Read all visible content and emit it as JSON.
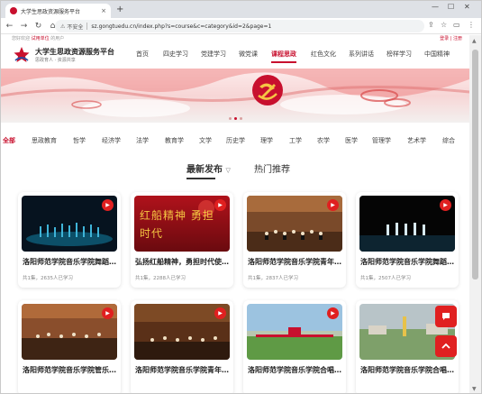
{
  "browser": {
    "tab_title": "大学生思政资源服务平台",
    "tab_close": "×",
    "new_tab": "+",
    "security_label": "不安全",
    "url": "sz.gongtuedu.cn/index.php?s=course&c=category&id=2&page=1"
  },
  "topline": {
    "prefix": "您好欢迎",
    "link": "试用单位",
    "suffix": "的用户",
    "right": "登录 | 注册"
  },
  "site": {
    "title": "大学生思政资源服务平台",
    "subtitle": "思政育人 · 资源共享"
  },
  "main_nav": [
    "首页",
    "四史学习",
    "党建学习",
    "微党课",
    "课程思政",
    "红色文化",
    "系列讲话",
    "榜样学习",
    "中国精神"
  ],
  "main_nav_active": "课程思政",
  "categories": [
    "全部",
    "思政教育",
    "哲学",
    "经济学",
    "法学",
    "教育学",
    "文学",
    "历史学",
    "理学",
    "工学",
    "农学",
    "医学",
    "管理学",
    "艺术学",
    "综合"
  ],
  "sort_tabs": {
    "latest": "最新发布",
    "latest_arrow": "▽",
    "hot": "热门推荐"
  },
  "cards": [
    {
      "title": "洛阳师范学院音乐学院舞蹈...",
      "meta": "共1集，2635人已学习"
    },
    {
      "title": "弘扬红船精神，勇担时代使...",
      "meta": "共1集，2288人已学习",
      "art_text": "红船精神  勇担时代"
    },
    {
      "title": "洛阳师范学院音乐学院青年...",
      "meta": "共1集，2837人已学习"
    },
    {
      "title": "洛阳师范学院音乐学院舞蹈...",
      "meta": "共1集，2507人已学习"
    },
    {
      "title": "洛阳师范学院音乐学院管乐...",
      "meta": ""
    },
    {
      "title": "洛阳师范学院音乐学院青年...",
      "meta": ""
    },
    {
      "title": "洛阳师范学院音乐学院合唱...",
      "meta": ""
    },
    {
      "title": "洛阳师范学院音乐学院合唱...",
      "meta": ""
    }
  ],
  "colors": {
    "accent": "#c8102e",
    "play": "#e02020"
  },
  "icons": {
    "float_top": "chat-icon",
    "float_bottom": "back-to-top-icon"
  }
}
